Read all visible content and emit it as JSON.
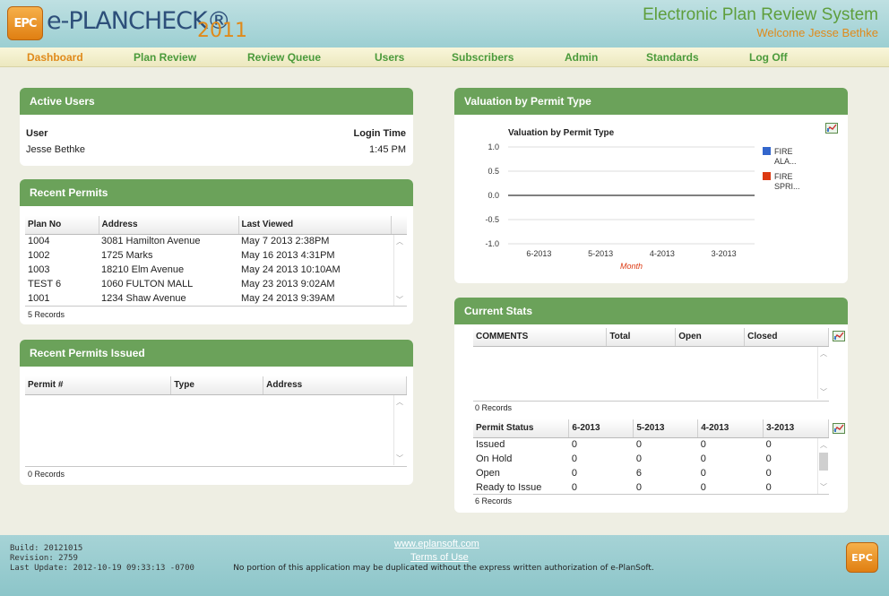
{
  "header": {
    "logo_mark": "EPC",
    "logo_text": "e-PLANCHECK®",
    "logo_year": "2011",
    "system_title": "Electronic Plan Review System",
    "welcome": "Welcome Jesse Bethke"
  },
  "nav": {
    "items": [
      "Dashboard",
      "Plan Review",
      "Review Queue",
      "Users",
      "Subscribers",
      "Admin",
      "Standards",
      "Log Off"
    ],
    "active": "Dashboard"
  },
  "active_users": {
    "title": "Active Users",
    "col_user": "User",
    "col_login": "Login Time",
    "rows": [
      {
        "user": "Jesse Bethke",
        "time": "1:45 PM"
      }
    ]
  },
  "recent_permits": {
    "title": "Recent Permits",
    "columns": [
      "Plan No",
      "Address",
      "Last Viewed"
    ],
    "rows": [
      [
        "1004",
        "3081 Hamilton Avenue",
        "May 7 2013 2:38PM"
      ],
      [
        "1002",
        "1725 Marks",
        "May 16 2013 4:31PM"
      ],
      [
        "1003",
        "18210 Elm Avenue",
        "May 24 2013 10:10AM"
      ],
      [
        "TEST 6",
        "1060 FULTON MALL",
        "May 23 2013 9:02AM"
      ],
      [
        "1001",
        "1234 Shaw Avenue",
        "May 24 2013 9:39AM"
      ]
    ],
    "records": "5 Records"
  },
  "recent_issued": {
    "title": "Recent Permits Issued",
    "columns": [
      "Permit #",
      "Type",
      "Address"
    ],
    "records": "0 Records"
  },
  "valuation": {
    "title": "Valuation by Permit Type",
    "icon": "chart-export-icon"
  },
  "chart_data": {
    "type": "line",
    "title": "Valuation by Permit Type",
    "xlabel": "Month",
    "ylabel": "",
    "categories": [
      "6-2013",
      "5-2013",
      "4-2013",
      "3-2013"
    ],
    "yticks": [
      "1.0",
      "0.5",
      "0.0",
      "-0.5",
      "-1.0"
    ],
    "ylim": [
      -1.0,
      1.0
    ],
    "series": [
      {
        "name": "FIRE ALA...",
        "values": [
          0,
          0,
          0,
          0
        ],
        "color": "#3366cc"
      },
      {
        "name": "FIRE SPRI...",
        "values": [
          0,
          0,
          0,
          0
        ],
        "color": "#dc3912"
      }
    ],
    "legend_position": "right",
    "grid": true
  },
  "current_stats": {
    "title": "Current Stats",
    "comments_columns": [
      "COMMENTS",
      "Total",
      "Open",
      "Closed"
    ],
    "comments_records": "0 Records",
    "status_columns": [
      "Permit Status",
      "6-2013",
      "5-2013",
      "4-2013",
      "3-2013"
    ],
    "status_rows": [
      [
        "Issued",
        "0",
        "0",
        "0",
        "0"
      ],
      [
        "On Hold",
        "0",
        "0",
        "0",
        "0"
      ],
      [
        "Open",
        "0",
        "6",
        "0",
        "0"
      ],
      [
        "Ready to Issue",
        "0",
        "0",
        "0",
        "0"
      ]
    ],
    "status_records": "6 Records"
  },
  "footer": {
    "build": "Build: 20121015",
    "revision": "Revision: 2759",
    "last_update": "Last Update: 2012-10-19 09:33:13 -0700",
    "site_link": "www.eplansoft.com",
    "terms_link": "Terms of Use",
    "notice": "No portion of this application may be duplicated without the express written authorization of e-PlanSoft.",
    "logo_mark": "EPC"
  }
}
